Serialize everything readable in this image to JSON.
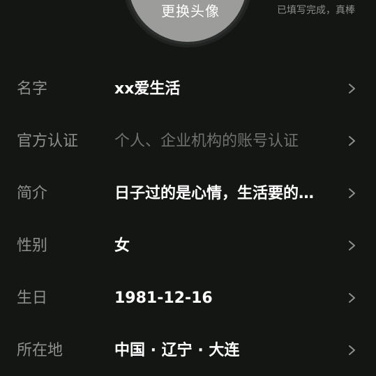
{
  "header": {
    "avatar_label": "更换头像",
    "complete_text": "已填写完成，真棒"
  },
  "rows": [
    {
      "label": "名字",
      "value": "xx爱生活"
    },
    {
      "label": "官方认证",
      "value": "个人、企业机构的账号认证"
    },
    {
      "label": "简介",
      "value": "日子过的是心情，生活要的…"
    },
    {
      "label": "性别",
      "value": "女"
    },
    {
      "label": "生日",
      "value": "1981-12-16"
    },
    {
      "label": "所在地",
      "value": "中国 · 辽宁 · 大连"
    }
  ],
  "icons": {
    "row_arrow": "chevron-right-icon"
  },
  "colors": {
    "background": "#141614",
    "label": "#8d908e",
    "value": "#ffffff",
    "placeholder": "#6f7270"
  }
}
